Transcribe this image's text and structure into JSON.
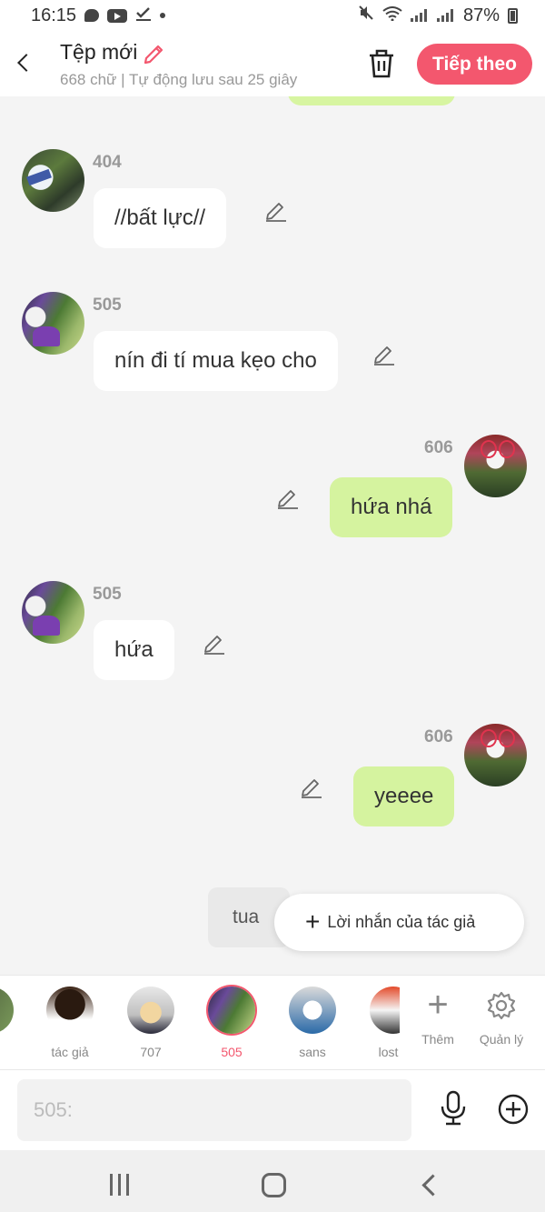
{
  "status_bar": {
    "time": "16:15",
    "battery": "87%"
  },
  "header": {
    "title": "Tệp mới",
    "subtitle": "668 chữ | Tự động lưu sau 25 giây",
    "next_label": "Tiếp theo"
  },
  "messages": [
    {
      "sender": "404",
      "text": "//bất lực//",
      "side": "left"
    },
    {
      "sender": "505",
      "text": "nín đi tí mua kẹo cho",
      "side": "left"
    },
    {
      "sender": "606",
      "text": "hứa nhá",
      "side": "right"
    },
    {
      "sender": "505",
      "text": "hứa",
      "side": "left"
    },
    {
      "sender": "606",
      "text": "yeeee",
      "side": "right"
    }
  ],
  "draft_chip": "tua",
  "author_note_label": "Lời nhắn của tác giả",
  "characters": [
    {
      "label": ""
    },
    {
      "label": "tác giả"
    },
    {
      "label": "707"
    },
    {
      "label": "505",
      "active": true
    },
    {
      "label": "sans"
    },
    {
      "label": "lost s"
    }
  ],
  "tools": {
    "add_label": "Thêm",
    "manage_label": "Quản lý"
  },
  "input": {
    "placeholder": "505:",
    "value": ""
  },
  "colors": {
    "accent": "#f3576e",
    "right_bubble": "#d5f39f",
    "left_bubble": "#ffffff",
    "background": "#f4f4f4"
  }
}
